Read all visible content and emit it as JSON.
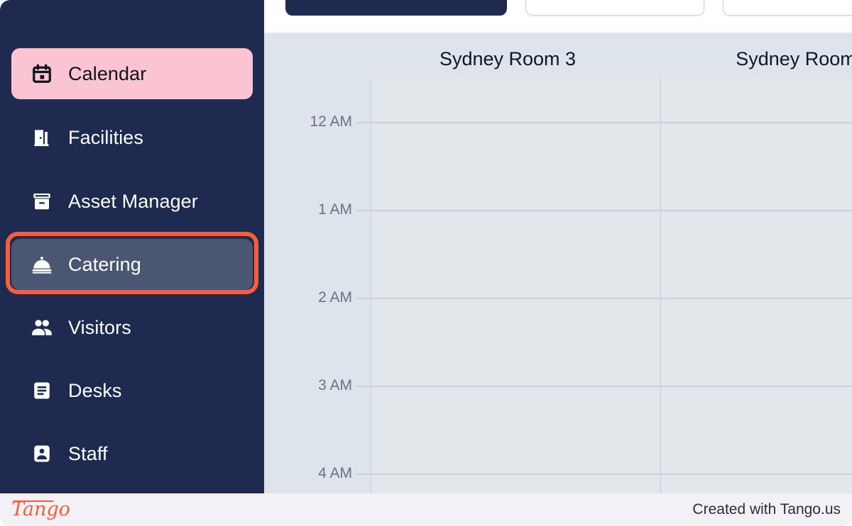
{
  "app": {
    "accent_orange": "#fb5d3c",
    "sidebar_bg": "#1e2a4f",
    "active_pink": "#fbc4d2",
    "highlight_bg": "#4b5672",
    "calendar_bg": "#dde4ec",
    "grid_bg": "#e2e7eb"
  },
  "sidebar": {
    "items": [
      {
        "id": "calendar",
        "label": "Calendar",
        "icon": "calendar-icon",
        "state": "selected"
      },
      {
        "id": "facilities",
        "label": "Facilities",
        "icon": "door-icon",
        "state": "default"
      },
      {
        "id": "asset-manager",
        "label": "Asset Manager",
        "icon": "archive-box-icon",
        "state": "default"
      },
      {
        "id": "catering",
        "label": "Catering",
        "icon": "room-service-icon",
        "state": "highlighted"
      },
      {
        "id": "visitors",
        "label": "Visitors",
        "icon": "people-icon",
        "state": "default"
      },
      {
        "id": "desks",
        "label": "Desks",
        "icon": "document-lines-icon",
        "state": "default"
      },
      {
        "id": "staff",
        "label": "Staff",
        "icon": "person-badge-icon",
        "state": "default"
      }
    ]
  },
  "topbar": {
    "chips": [
      {
        "id": "chip-1",
        "label": "",
        "style": "primary"
      },
      {
        "id": "chip-2",
        "label": "",
        "style": "ghost"
      },
      {
        "id": "chip-3",
        "label": "",
        "style": "ghost"
      }
    ]
  },
  "calendar": {
    "columns": [
      {
        "label": "Sydney Room 3"
      },
      {
        "label": "Sydney Room"
      }
    ],
    "hours": [
      "12 AM",
      "1 AM",
      "2 AM",
      "3 AM",
      "4 AM"
    ]
  },
  "footer": {
    "logo": "Tango",
    "credit": "Created with Tango.us"
  }
}
